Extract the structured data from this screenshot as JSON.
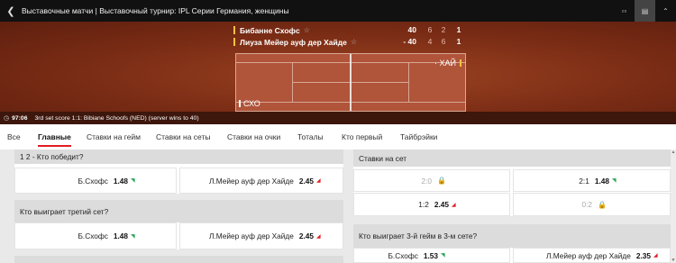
{
  "header": {
    "back_icon": "chevron-left-icon",
    "breadcrumb": "Выставочные матчи | Выставочный турнир: IPL Серии Германия, женщины",
    "icons": [
      "split-view-icon",
      "scoreboard-icon",
      "collapse-icon"
    ]
  },
  "match": {
    "player1": {
      "name": "Бибанне Схофс",
      "points": "40",
      "set1": "6",
      "set2": "2",
      "set3": "1"
    },
    "player2": {
      "name": "Лиуза Мейер ауф дер Хайде",
      "points": "- 40",
      "set1": "4",
      "set2": "6",
      "set3": "1"
    },
    "court_left_label": "СХО",
    "court_right_label": "· ХАЙ",
    "time": "97:06",
    "status": "3rd set score 1:1: Bibiane Schoofs (NED) (server wins to 40)"
  },
  "tabs": [
    "Все",
    "Главные",
    "Ставки на гейм",
    "Ставки на сеты",
    "Ставки на очки",
    "Тоталы",
    "Кто первый",
    "Тайбрэйки"
  ],
  "active_tab": "Главные",
  "markets": {
    "winner": {
      "title": "1 2 - Кто победит?",
      "left": {
        "name": "Б.Схофс",
        "odd": "1.48",
        "trend": "up"
      },
      "right": {
        "name": "Л.Мейер ауф дер Хайде",
        "odd": "2.45",
        "trend": "down"
      }
    },
    "third_set": {
      "title": "Кто выиграет третий сет?",
      "left": {
        "name": "Б.Схофс",
        "odd": "1.48",
        "trend": "up"
      },
      "right": {
        "name": "Л.Мейер ауф дер Хайде",
        "odd": "2.45",
        "trend": "down"
      }
    },
    "set_bet": {
      "title": "Ставки на сет",
      "r1_left": {
        "name": "2:0",
        "locked": true
      },
      "r1_right": {
        "name": "2:1",
        "odd": "1.48",
        "trend": "up"
      },
      "r2_left": {
        "name": "1:2",
        "odd": "2.45",
        "trend": "down"
      },
      "r2_right": {
        "name": "0:2",
        "locked": true
      }
    },
    "game3": {
      "title": "Кто выиграет 3-й гейм в 3-м сете?",
      "left": {
        "name": "Б.Схофс",
        "odd": "1.53",
        "trend": "up"
      },
      "right": {
        "name": "Л.Мейер ауф дер Хайде",
        "odd": "2.35",
        "trend": "down"
      }
    }
  },
  "colors": {
    "accent": "#e21c24",
    "up": "#2aa65a",
    "court": "#b0543a",
    "server": "#f5c242"
  }
}
